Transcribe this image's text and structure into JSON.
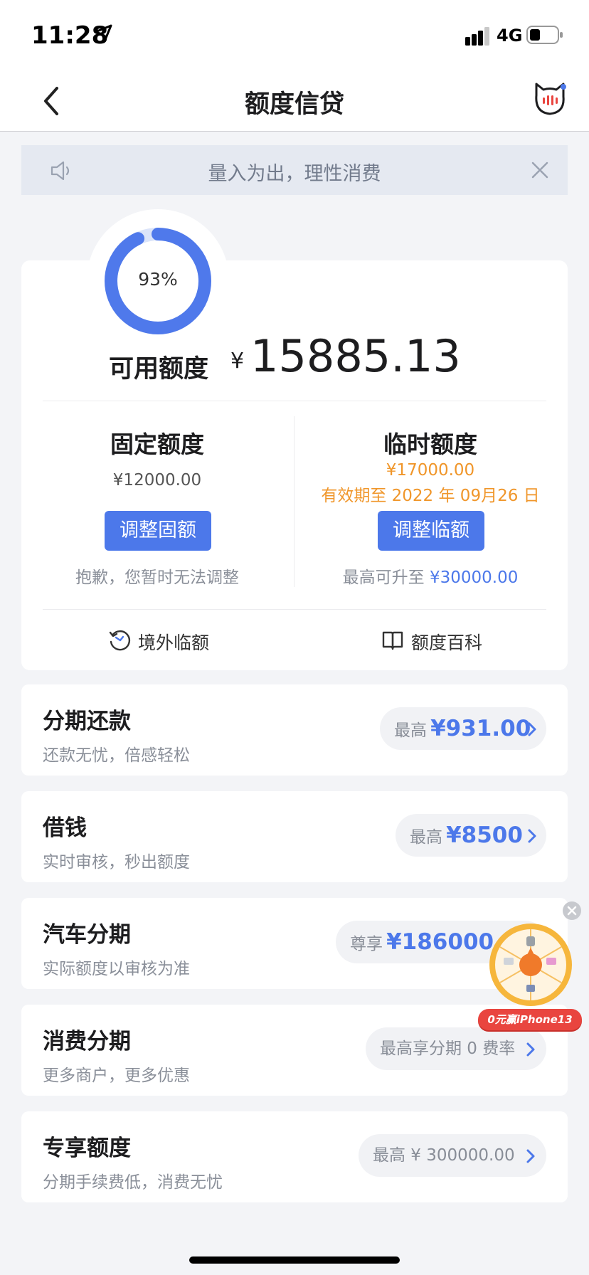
{
  "status_bar": {
    "time": "11:28",
    "network": "4G",
    "icons": [
      "location-arrow-icon",
      "signal-icon",
      "battery-icon"
    ]
  },
  "nav": {
    "title": "额度信贷",
    "icons": [
      "back-chevron-icon",
      "cat-mascot-icon"
    ]
  },
  "notice": {
    "text": "量入为出，理性消费",
    "icons": [
      "speaker-icon",
      "close-icon"
    ]
  },
  "credit": {
    "usage_percent": 93,
    "usage_percent_label": "93%",
    "available_label": "可用额度",
    "currency": "¥",
    "available_value": "15885.13",
    "fixed": {
      "title": "固定额度",
      "amount": "¥12000.00",
      "button": "调整固额",
      "note": "抱歉，您暂时无法调整"
    },
    "temporary": {
      "title": "临时额度",
      "amount": "¥17000.00",
      "validity": "有效期至 2022 年 09月26 日",
      "button": "调整临额",
      "note_prefix": "最高可升至",
      "note_value": "¥30000.00"
    },
    "links": [
      {
        "label": "境外临额",
        "icon": "overseas-quota-icon"
      },
      {
        "label": "额度百科",
        "icon": "book-icon"
      }
    ]
  },
  "products": [
    {
      "title": "分期还款",
      "subtitle": "还款无忧，倍感轻松",
      "prefix": "最高",
      "value": "¥931.00"
    },
    {
      "title": "借钱",
      "subtitle": "实时审核，秒出额度",
      "prefix": "最高",
      "value": "¥8500"
    },
    {
      "title": "汽车分期",
      "subtitle": "实际额度以审核为准",
      "prefix": "尊享",
      "value": "¥186000.0"
    },
    {
      "title": "消费分期",
      "subtitle": "更多商户，更多优惠",
      "text": "最高享分期 0 费率"
    },
    {
      "title": "专享额度",
      "subtitle": "分期手续费低，消费无忧",
      "text": "最高 ¥ 300000.00"
    }
  ],
  "promo": {
    "banner": "0元赢iPhone13",
    "icons": [
      "prize-wheel-icon",
      "close-icon"
    ]
  },
  "colors": {
    "accent": "#4c78ea",
    "orange": "#f0962a",
    "background": "#f3f4f7"
  }
}
